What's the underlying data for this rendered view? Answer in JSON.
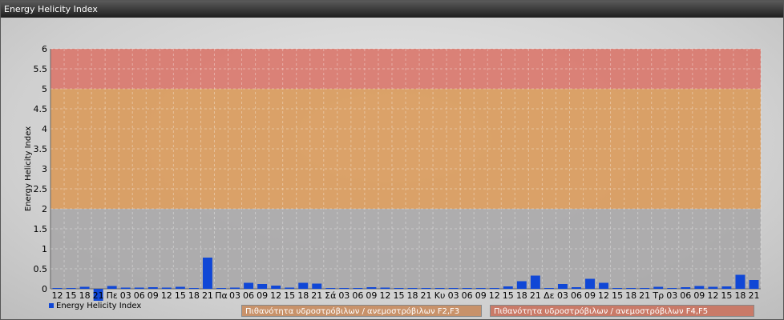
{
  "window": {
    "title": "Energy Helicity Index"
  },
  "chart_data": {
    "type": "bar",
    "ylabel": "Energy Helicity Index",
    "ylim": [
      0,
      6
    ],
    "yticks": [
      "0",
      "0.5",
      "1",
      "1.5",
      "2",
      "2.5",
      "3",
      "3.5",
      "4",
      "4.5",
      "5",
      "5.5",
      "6"
    ],
    "categories": [
      "12",
      "15",
      "18",
      "21",
      "Πε",
      "03",
      "06",
      "09",
      "12",
      "15",
      "18",
      "21",
      "Πα",
      "03",
      "06",
      "09",
      "12",
      "15",
      "18",
      "21",
      "Σά",
      "03",
      "06",
      "09",
      "12",
      "15",
      "18",
      "21",
      "Κυ",
      "03",
      "06",
      "09",
      "12",
      "15",
      "18",
      "21",
      "Δε",
      "03",
      "06",
      "09",
      "12",
      "15",
      "18",
      "21",
      "Τρ",
      "03",
      "06",
      "09",
      "12",
      "15",
      "18",
      "21"
    ],
    "series": [
      {
        "name": "Energy Helicity Index",
        "values": [
          0.02,
          0.02,
          0.05,
          -0.3,
          0.07,
          0.03,
          0.03,
          0.04,
          0.03,
          0.05,
          0.02,
          0.78,
          0.02,
          0.03,
          0.15,
          0.12,
          0.08,
          0.03,
          0.15,
          0.13,
          0.02,
          0.02,
          0.02,
          0.04,
          0.03,
          0.02,
          0.02,
          0.02,
          0.02,
          0.02,
          0.02,
          0.02,
          0.02,
          0.06,
          0.19,
          0.33,
          0.02,
          0.12,
          0.04,
          0.25,
          0.15,
          0.02,
          0.02,
          0.02,
          0.05,
          0.02,
          0.04,
          0.07,
          0.05,
          0.06,
          0.35,
          0.22
        ]
      }
    ],
    "bands": [
      {
        "label": "",
        "from": 0,
        "to": 2,
        "color": "#a9a7a8"
      },
      {
        "label": "Πιθανότητα υδροστρόβιλων / ανεμοστρόβιλων F2,F3",
        "from": 2,
        "to": 5,
        "color": "#d99a5b"
      },
      {
        "label": "Πιθανότητα υδροστρόβιλων / ανεμοστρόβιλων F4,F5",
        "from": 5,
        "to": 6,
        "color": "#d9776b"
      }
    ],
    "bar_color": "#1047d6",
    "legend_position": "bottom-left",
    "grid": true
  }
}
